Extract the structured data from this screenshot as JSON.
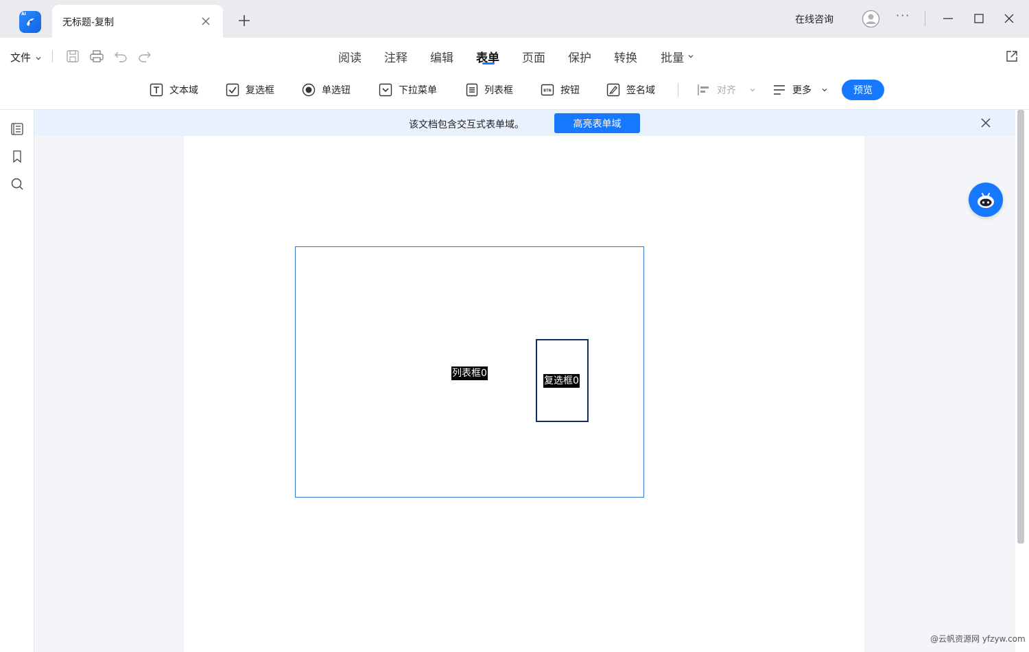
{
  "app": {
    "logo_tag": "AI",
    "tab_title": "无标题-复制",
    "online_consult": "在线咨询",
    "more": "···"
  },
  "menu": {
    "file": "文件",
    "nav_tabs": [
      "阅读",
      "注释",
      "编辑",
      "表单",
      "页面",
      "保护",
      "转换",
      "批量"
    ],
    "active_tab": "表单"
  },
  "toolbar": {
    "text_field": "文本域",
    "checkbox": "复选框",
    "radio": "单选钮",
    "dropdown": "下拉菜单",
    "listbox": "列表框",
    "button": "按钮",
    "signature": "签名域",
    "align": "对齐",
    "more": "更多",
    "preview": "预览"
  },
  "notice": {
    "text": "该文档包含交互式表单域。",
    "highlight_button": "高亮表单域"
  },
  "document": {
    "listbox_field_label": "列表框0",
    "checkbox_field_label": "复选框0"
  },
  "watermark": "@云帆资源网 yfzyw.com",
  "colors": {
    "accent": "#1677ff",
    "field_border": "#2b74c9",
    "checkbox_border": "#0d2f66"
  }
}
